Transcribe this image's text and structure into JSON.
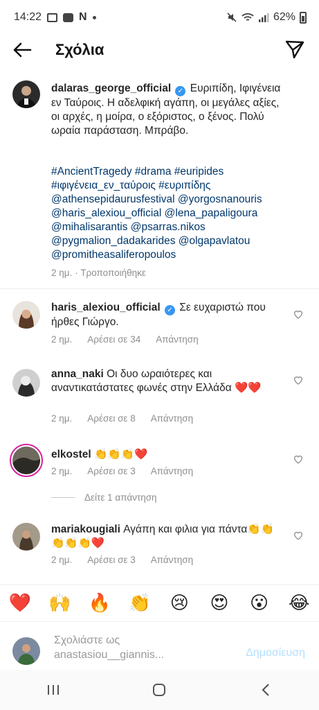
{
  "status_bar": {
    "time": "14:22",
    "n_icon": "N",
    "battery": "62%"
  },
  "header": {
    "title": "Σχόλια"
  },
  "post": {
    "username": "dalaras_george_official",
    "text": "Ευριπίδη, Ιφιγένεια εν Ταύροις. Η αδελφική αγάπη, οι μεγάλες αξίες, οι αρχές, η μοίρα, ο εξόριστος, ο ξένος. Πολύ ωραία παράσταση. Μπράβο.",
    "tags": "#AncientTragedy #drama #euripides #ιφιγένεια_εν_ταύροις #ευριπίδης @athensepidaurusfestival @yorgosnanouris @haris_alexiou_official @lena_papaligoura @mihalisarantis @psarras.nikos @pygmalion_dadakarides @olgapavlatou @promitheasaliferopoulos",
    "time": "2 ημ.",
    "edited": "Τροποποιήθηκε"
  },
  "comments": [
    {
      "username": "haris_alexiou_official",
      "verified": true,
      "text": "Σε ευχαριστώ που ήρθες Γιώργο.",
      "time": "2 ημ.",
      "likes": "Αρέσει σε 34",
      "reply": "Απάντηση"
    },
    {
      "username": "anna_naki",
      "verified": false,
      "text": "Οι δυο ωραιότερες και αναντικατάστατες φωνές στην Ελλάδα ❤️❤️",
      "time": "2 ημ.",
      "likes": "Αρέσει σε 8",
      "reply": "Απάντηση"
    },
    {
      "username": "elkostel",
      "verified": false,
      "text": "👏👏👏❤️",
      "time": "2 ημ.",
      "likes": "Αρέσει σε 3",
      "reply": "Απάντηση"
    },
    {
      "username": "mariakougiali",
      "verified": false,
      "text": "Αγάπη και φιλια για πάντα👏👏👏👏👏❤️",
      "time": "2 ημ.",
      "likes": "Αρέσει σε 3",
      "reply": "Απάντηση"
    }
  ],
  "view_replies": "Δείτε 1 απάντηση",
  "emoji_bar": [
    "❤️",
    "🙌",
    "🔥",
    "👏",
    "😢",
    "😍",
    "😮",
    "😂"
  ],
  "composer": {
    "placeholder_line1": "Σχολιάστε ως",
    "placeholder_line2": "anastasiou__giannis...",
    "post_label": "Δημοσίευση"
  },
  "colors": {
    "link": "#00376b",
    "verified": "#3897f0",
    "meta": "#8e8e8e",
    "post_disabled": "#b2dffc"
  }
}
